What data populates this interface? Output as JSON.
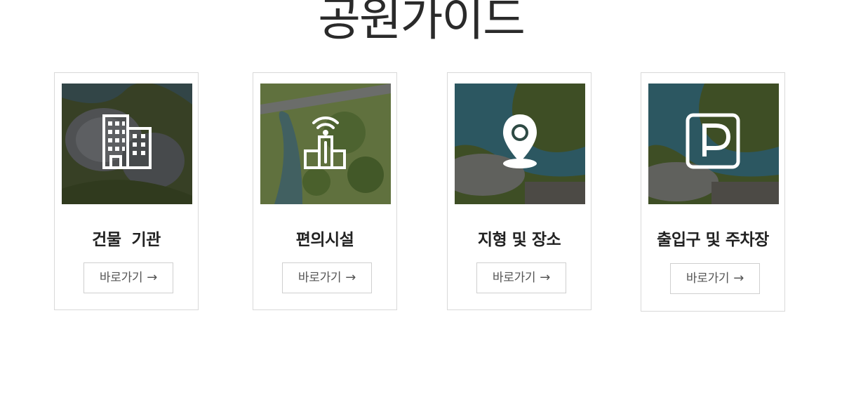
{
  "page": {
    "title": "공원가이드"
  },
  "cards": [
    {
      "title": "건물  기관",
      "button": "바로가기",
      "arrow": "→",
      "icon": "building-icon"
    },
    {
      "title": "편의시설",
      "button": "바로가기",
      "arrow": "→",
      "icon": "facility-signal-icon"
    },
    {
      "title": "지형 및 장소",
      "button": "바로가기",
      "arrow": "→",
      "icon": "location-pin-icon"
    },
    {
      "title": "출입구 및 주차장",
      "button": "바로가기",
      "arrow": "→",
      "icon": "parking-icon"
    }
  ],
  "colors": {
    "overlay": "#2b3a1f",
    "map_green": "#6d8a3a",
    "map_water": "#3f7d8c",
    "border": "#d9d9d9",
    "icon": "#ffffff"
  }
}
